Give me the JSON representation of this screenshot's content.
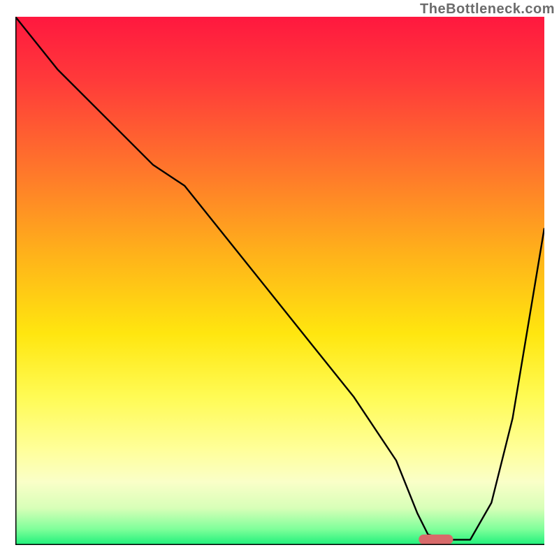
{
  "watermark": "TheBottleneck.com",
  "chart_data": {
    "type": "line",
    "title": "",
    "xlabel": "",
    "ylabel": "",
    "xlim": [
      0,
      100
    ],
    "ylim": [
      0,
      100
    ],
    "gradient_stops": [
      {
        "offset": 0,
        "color": "#ff183f"
      },
      {
        "offset": 12,
        "color": "#ff3a3a"
      },
      {
        "offset": 30,
        "color": "#ff7a2a"
      },
      {
        "offset": 45,
        "color": "#ffb21a"
      },
      {
        "offset": 60,
        "color": "#ffe60f"
      },
      {
        "offset": 72,
        "color": "#fffb55"
      },
      {
        "offset": 82,
        "color": "#ffff9a"
      },
      {
        "offset": 88,
        "color": "#faffc8"
      },
      {
        "offset": 93,
        "color": "#d8ffb8"
      },
      {
        "offset": 97,
        "color": "#7fff9a"
      },
      {
        "offset": 100,
        "color": "#1df07a"
      }
    ],
    "series": [
      {
        "name": "bottleneck-curve",
        "x": [
          0,
          8,
          18,
          26,
          32,
          40,
          48,
          56,
          64,
          72,
          76,
          78,
          82,
          86,
          90,
          94,
          98,
          100
        ],
        "y": [
          100,
          90,
          80,
          72,
          68,
          58,
          48,
          38,
          28,
          16,
          6,
          2,
          1,
          1,
          8,
          24,
          48,
          60
        ]
      }
    ],
    "marker": {
      "name": "optimal-marker",
      "x": 79.5,
      "width": 6.5,
      "color": "#d86a6a"
    },
    "axes": {
      "left": {
        "color": "#000000",
        "width": 3
      },
      "bottom": {
        "color": "#000000",
        "width": 3
      }
    }
  }
}
